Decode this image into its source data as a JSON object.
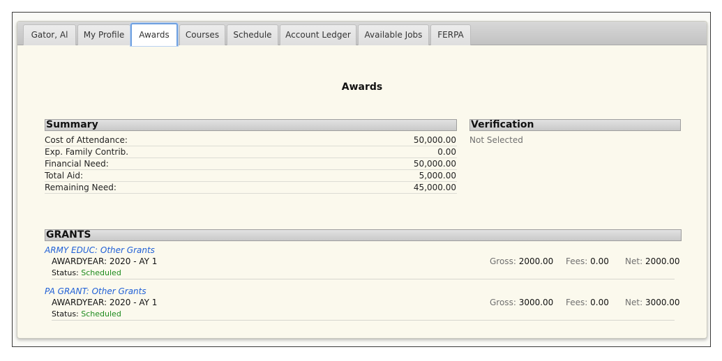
{
  "tabs": [
    {
      "label": "Gator, Al"
    },
    {
      "label": "My Profile"
    },
    {
      "label": "Awards"
    },
    {
      "label": "Courses"
    },
    {
      "label": "Schedule"
    },
    {
      "label": "Account Ledger"
    },
    {
      "label": "Available Jobs"
    },
    {
      "label": "FERPA"
    }
  ],
  "active_tab": "Awards",
  "page_title": "Awards",
  "summary": {
    "header": "Summary",
    "rows": [
      {
        "label": "Cost of Attendance:",
        "value": "50,000.00"
      },
      {
        "label": "Exp. Family Contrib.",
        "value": "0.00"
      },
      {
        "label": "Financial Need:",
        "value": "50,000.00"
      },
      {
        "label": "Total Aid:",
        "value": "5,000.00"
      },
      {
        "label": "Remaining Need:",
        "value": "45,000.00"
      }
    ]
  },
  "verification": {
    "header": "Verification",
    "status": "Not Selected"
  },
  "grants": {
    "header": "GRANTS",
    "items": [
      {
        "title": "ARMY EDUC: Other Grants",
        "awardyear": "AWARDYEAR: 2020 - AY 1",
        "status_label": "Status:",
        "status": "Scheduled",
        "gross_label": "Gross:",
        "gross": "2000.00",
        "fees_label": "Fees:",
        "fees": "0.00",
        "net_label": "Net:",
        "net": "2000.00"
      },
      {
        "title": "PA GRANT: Other Grants",
        "awardyear": "AWARDYEAR: 2020 - AY 1",
        "status_label": "Status:",
        "status": "Scheduled",
        "gross_label": "Gross:",
        "gross": "3000.00",
        "fees_label": "Fees:",
        "fees": "0.00",
        "net_label": "Net:",
        "net": "3000.00"
      }
    ]
  },
  "colors": {
    "background": "#fbf9ed",
    "link": "#1f5fd6",
    "status_scheduled": "#1c8a1c",
    "active_tab_border": "#6fa0e0"
  }
}
